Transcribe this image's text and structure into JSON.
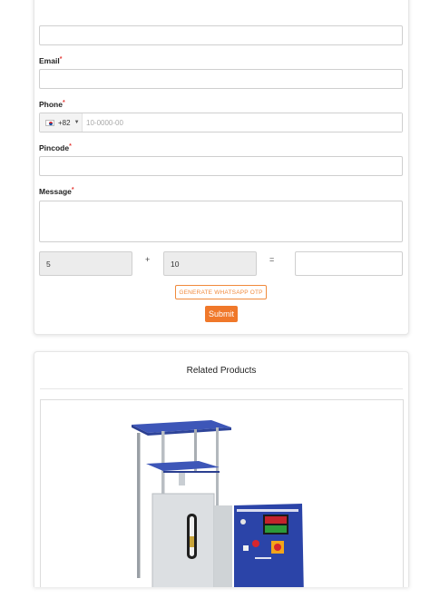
{
  "form": {
    "email_label": "Email",
    "phone_label": "Phone",
    "pincode_label": "Pincode",
    "message_label": "Message",
    "required_mark": "*",
    "phone": {
      "country_code": "+82",
      "flag": "south-korea-flag-icon",
      "placeholder": "10-0000-00"
    },
    "captcha": {
      "operand_a": "5",
      "operator": "+",
      "operand_b": "10",
      "equals": "="
    },
    "otp_button": "GENERATE WHATSAPP OTP",
    "submit_button": "Submit",
    "accent_color": "#f0782a"
  },
  "related": {
    "title": "Related Products",
    "product_image": "compression-testing-machine-image"
  }
}
